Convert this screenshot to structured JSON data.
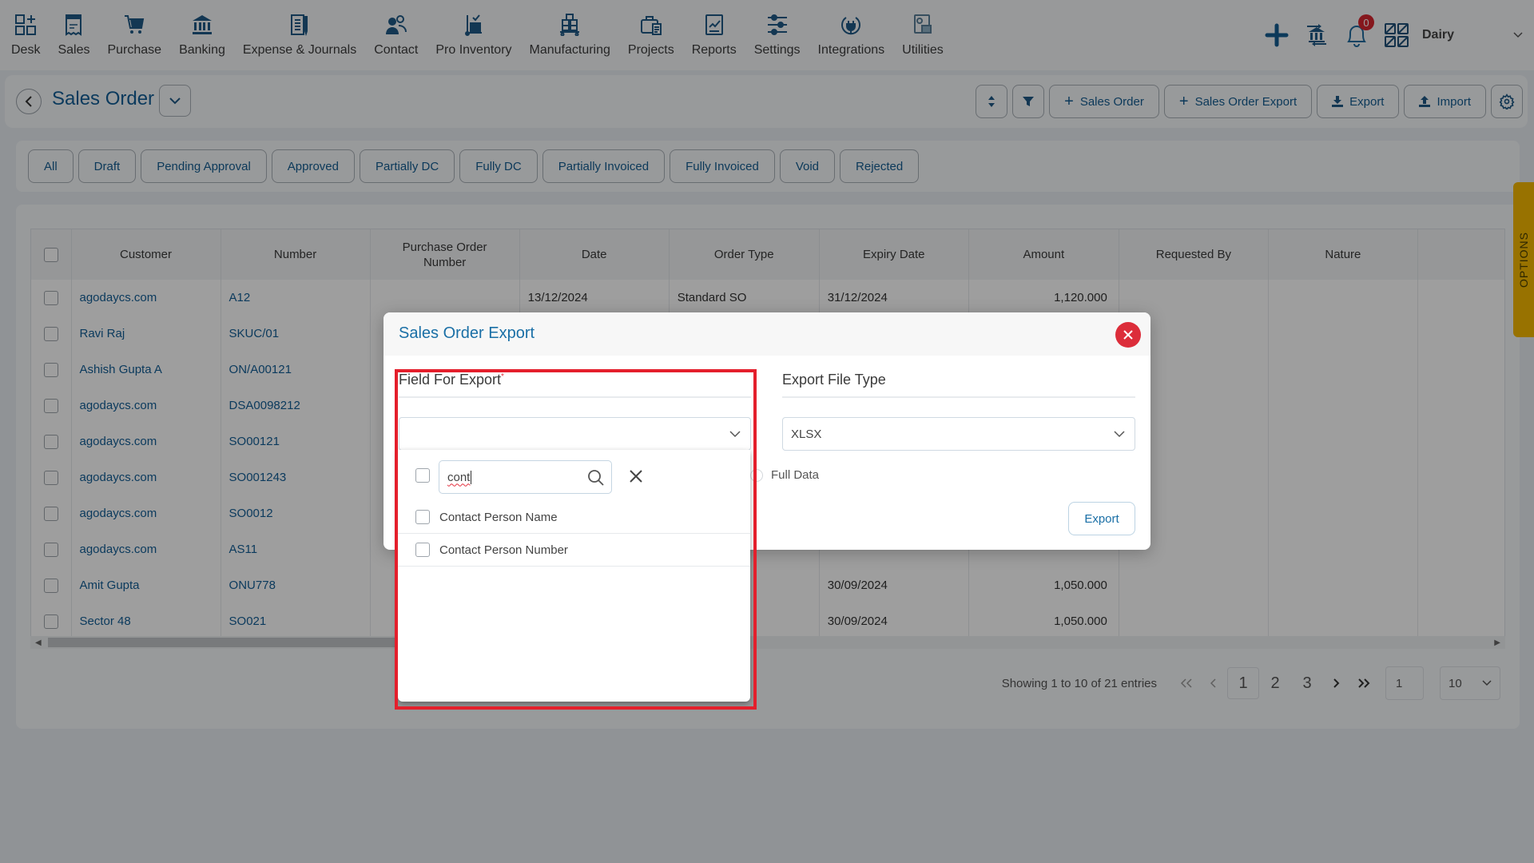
{
  "nav": {
    "items": [
      {
        "label": "Desk",
        "icon": "desk-icon"
      },
      {
        "label": "Sales",
        "icon": "receipt-icon"
      },
      {
        "label": "Purchase",
        "icon": "cart-icon"
      },
      {
        "label": "Banking",
        "icon": "bank-icon"
      },
      {
        "label": "Expense & Journals",
        "icon": "notebook-icon"
      },
      {
        "label": "Contact",
        "icon": "contacts-icon"
      },
      {
        "label": "Pro Inventory",
        "icon": "trolley-icon"
      },
      {
        "label": "Manufacturing",
        "icon": "pallet-icon"
      },
      {
        "label": "Projects",
        "icon": "briefcase-icon"
      },
      {
        "label": "Reports",
        "icon": "report-chart-icon"
      },
      {
        "label": "Settings",
        "icon": "sliders-icon"
      },
      {
        "label": "Integrations",
        "icon": "plug-icon"
      },
      {
        "label": "Utilities",
        "icon": "utilities-icon"
      }
    ],
    "notification_count": "0",
    "company": "Dairy"
  },
  "header": {
    "title": "Sales Order",
    "actions": {
      "add_sales_order": "Sales Order",
      "add_sales_order_export": "Sales Order Export",
      "export": "Export",
      "import": "Import"
    }
  },
  "tabs": [
    "All",
    "Draft",
    "Pending Approval",
    "Approved",
    "Partially DC",
    "Fully DC",
    "Partially Invoiced",
    "Fully Invoiced",
    "Void",
    "Rejected"
  ],
  "table": {
    "columns": [
      "Customer",
      "Number",
      "Purchase Order Number",
      "Date",
      "Order Type",
      "Expiry Date",
      "Amount",
      "Requested By",
      "Nature"
    ],
    "rows": [
      {
        "customer": "agodaycs.com",
        "number": "A12",
        "po": "",
        "date": "13/12/2024",
        "order_type": "Standard SO",
        "expiry": "31/12/2024",
        "amount": "1,120.000",
        "requested_by": "",
        "nature": ""
      },
      {
        "customer": "Ravi Raj",
        "number": "SKUC/01",
        "po": "",
        "date": "",
        "order_type": "",
        "expiry": "",
        "amount": "",
        "requested_by": "",
        "nature": ""
      },
      {
        "customer": "Ashish Gupta A",
        "number": "ON/A00121",
        "po": "",
        "date": "",
        "order_type": "",
        "expiry": "",
        "amount": "",
        "requested_by": "",
        "nature": ""
      },
      {
        "customer": "agodaycs.com",
        "number": "DSA0098212",
        "po": "",
        "date": "",
        "order_type": "",
        "expiry": "",
        "amount": "",
        "requested_by": "",
        "nature": ""
      },
      {
        "customer": "agodaycs.com",
        "number": "SO00121",
        "po": "",
        "date": "",
        "order_type": "",
        "expiry": "",
        "amount": "",
        "requested_by": "",
        "nature": ""
      },
      {
        "customer": "agodaycs.com",
        "number": "SO001243",
        "po": "",
        "date": "",
        "order_type": "",
        "expiry": "",
        "amount": "",
        "requested_by": "",
        "nature": ""
      },
      {
        "customer": "agodaycs.com",
        "number": "SO0012",
        "po": "",
        "date": "",
        "order_type": "",
        "expiry": "",
        "amount": "",
        "requested_by": "",
        "nature": ""
      },
      {
        "customer": "agodaycs.com",
        "number": "AS11",
        "po": "",
        "date": "",
        "order_type": "",
        "expiry": "",
        "amount": "",
        "requested_by": "",
        "nature": ""
      },
      {
        "customer": "Amit Gupta",
        "number": "ONU778",
        "po": "",
        "date": "",
        "order_type": "",
        "expiry": "30/09/2024",
        "amount": "1,050.000",
        "requested_by": "",
        "nature": ""
      },
      {
        "customer": "Sector 48",
        "number": "SO021",
        "po": "",
        "date": "",
        "order_type": "",
        "expiry": "30/09/2024",
        "amount": "1,050.000",
        "requested_by": "",
        "nature": ""
      }
    ]
  },
  "pagination": {
    "info": "Showing 1 to 10 of 21 entries",
    "pages": [
      "1",
      "2",
      "3"
    ],
    "current_page": "1",
    "goto_value": "1",
    "page_size": "10"
  },
  "options_tab": "OPTIONS",
  "modal": {
    "title": "Sales Order Export",
    "field_for_export_label": "Field For Export",
    "field_for_export_value": "",
    "export_file_type_label": "Export File Type",
    "export_file_type_value": "XLSX",
    "radio_full_data": "Full Data",
    "export_button": "Export",
    "dropdown": {
      "search_value": "cont",
      "options": [
        "Contact Person Name",
        "Contact Person Number"
      ]
    }
  }
}
